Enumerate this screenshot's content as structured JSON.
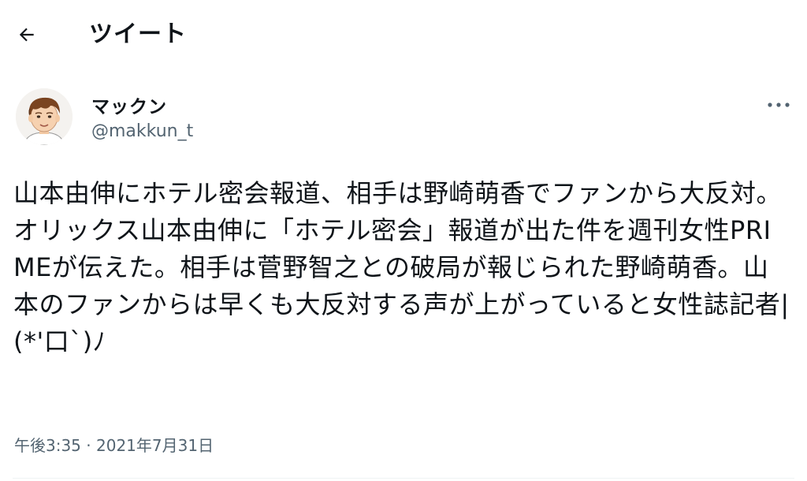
{
  "header": {
    "title": "ツイート"
  },
  "icons": {
    "back": "back-arrow-icon",
    "more": "more-horizontal-icon"
  },
  "author": {
    "display_name": "マックン",
    "handle": "@makkun_t"
  },
  "tweet": {
    "text": "山本由伸にホテル密会報道、相手は野崎萌香でファンから大反対。オリックス山本由伸に「ホテル密会」報道が出た件を週刊女性PRIMEが伝えた。相手は菅野智之との破局が報じられた野崎萌香。山本のファンからは早くも大反対する声が上がっていると女性誌記者|(*'口`)ﾉ",
    "time": "午後3:35",
    "separator": "·",
    "date": "2021年7月31日"
  },
  "colors": {
    "text": "#0f1419",
    "secondary": "#536471",
    "divider": "#eff3f4"
  }
}
